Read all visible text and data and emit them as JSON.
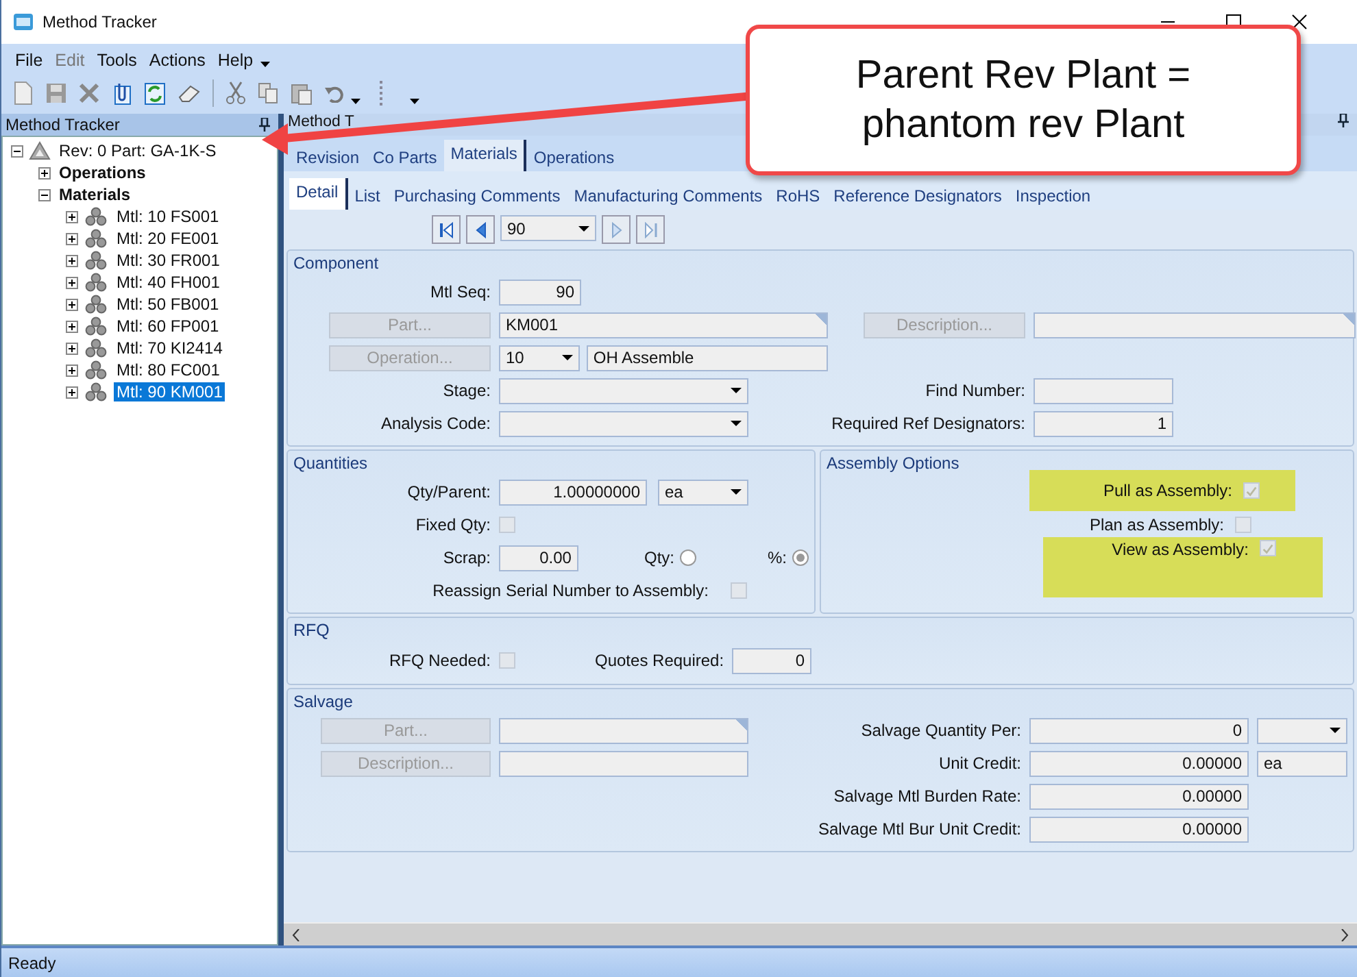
{
  "window": {
    "title": "Method Tracker"
  },
  "menu": [
    {
      "label": "File",
      "disabled": false
    },
    {
      "label": "Edit",
      "disabled": true
    },
    {
      "label": "Tools",
      "disabled": false
    },
    {
      "label": "Actions",
      "disabled": false
    },
    {
      "label": "Help",
      "disabled": false
    }
  ],
  "left_panel": {
    "title": "Method Tracker",
    "tree": {
      "label": "Rev: 0 Part: GA-1K-S",
      "expanded": true,
      "children": [
        {
          "label": "Operations",
          "expanded": false
        },
        {
          "label": "Materials",
          "expanded": true,
          "children": [
            {
              "label": "Mtl: 10 FS001",
              "selected": false
            },
            {
              "label": "Mtl: 20 FE001",
              "selected": false
            },
            {
              "label": "Mtl: 30 FR001",
              "selected": false
            },
            {
              "label": "Mtl: 40 FH001",
              "selected": false
            },
            {
              "label": "Mtl: 50 FB001",
              "selected": false
            },
            {
              "label": "Mtl: 60 FP001",
              "selected": false
            },
            {
              "label": "Mtl: 70 KI2414",
              "selected": false
            },
            {
              "label": "Mtl: 80 FC001",
              "selected": false
            },
            {
              "label": "Mtl: 90 KM001",
              "selected": true
            }
          ]
        }
      ]
    }
  },
  "right_panel": {
    "title": "Method T",
    "tabs": [
      {
        "label": "Revision",
        "selected": false
      },
      {
        "label": "Co Parts",
        "selected": false
      },
      {
        "label": "Materials",
        "selected": true
      },
      {
        "label": "Operations",
        "selected": false
      }
    ],
    "subtabs": [
      {
        "label": "Detail",
        "selected": true
      },
      {
        "label": "List",
        "selected": false
      },
      {
        "label": "Purchasing Comments",
        "selected": false
      },
      {
        "label": "Manufacturing Comments",
        "selected": false
      },
      {
        "label": "RoHS",
        "selected": false
      },
      {
        "label": "Reference Designators",
        "selected": false
      },
      {
        "label": "Inspection",
        "selected": false
      }
    ],
    "navigator": {
      "value": "90"
    },
    "component": {
      "title": "Component",
      "mtl_seq": {
        "label": "Mtl Seq:",
        "value": "90"
      },
      "part": {
        "button": "Part...",
        "value": "KM001"
      },
      "description": {
        "button": "Description..."
      },
      "operation": {
        "button": "Operation...",
        "value": "10",
        "description": "OH Assemble"
      },
      "stage": {
        "label": "Stage:"
      },
      "analysis_code": {
        "label": "Analysis Code:"
      },
      "find_number": {
        "label": "Find Number:"
      },
      "required_ref_designators": {
        "label": "Required Ref Designators:",
        "value": "1"
      }
    },
    "quantities": {
      "title": "Quantities",
      "qty_per_parent": {
        "label": "Qty/Parent:",
        "value": "1.00000000",
        "uom": "ea"
      },
      "fixed_qty": {
        "label": "Fixed Qty:",
        "checked": false
      },
      "scrap": {
        "label": "Scrap:",
        "value": "0.00"
      },
      "scrap_type": [
        {
          "label": "Qty:",
          "selected": false
        },
        {
          "label": "%:",
          "selected": true
        }
      ],
      "reassign_serial": {
        "label": "Reassign Serial Number to Assembly:",
        "checked": false
      }
    },
    "assembly_options": {
      "title": "Assembly Options",
      "options": [
        {
          "label": "Pull as Assembly:",
          "checked": true,
          "highlighted": true
        },
        {
          "label": "Plan as Assembly:",
          "checked": false,
          "highlighted": false
        },
        {
          "label": "View as Assembly:",
          "checked": true,
          "highlighted": true
        }
      ]
    },
    "rfq": {
      "title": "RFQ",
      "rfq_needed": {
        "label": "RFQ Needed:",
        "checked": false
      },
      "quotes_required": {
        "label": "Quotes Required:",
        "value": "0"
      }
    },
    "salvage": {
      "title": "Salvage",
      "part": {
        "button": "Part..."
      },
      "description": {
        "button": "Description..."
      },
      "quantity_per": {
        "label": "Salvage Quantity Per:",
        "value": "0"
      },
      "unit_credit": {
        "label": "Unit Credit:",
        "value": "0.00000",
        "uom": "ea"
      },
      "burden_rate": {
        "label": "Salvage Mtl Burden Rate:",
        "value": "0.00000"
      },
      "bur_unit_credit": {
        "label": "Salvage Mtl Bur Unit Credit:",
        "value": "0.00000"
      }
    }
  },
  "status_bar": {
    "text": "Ready"
  },
  "callout": {
    "lines": [
      "Parent Rev Plant =",
      "phantom rev Plant"
    ]
  }
}
